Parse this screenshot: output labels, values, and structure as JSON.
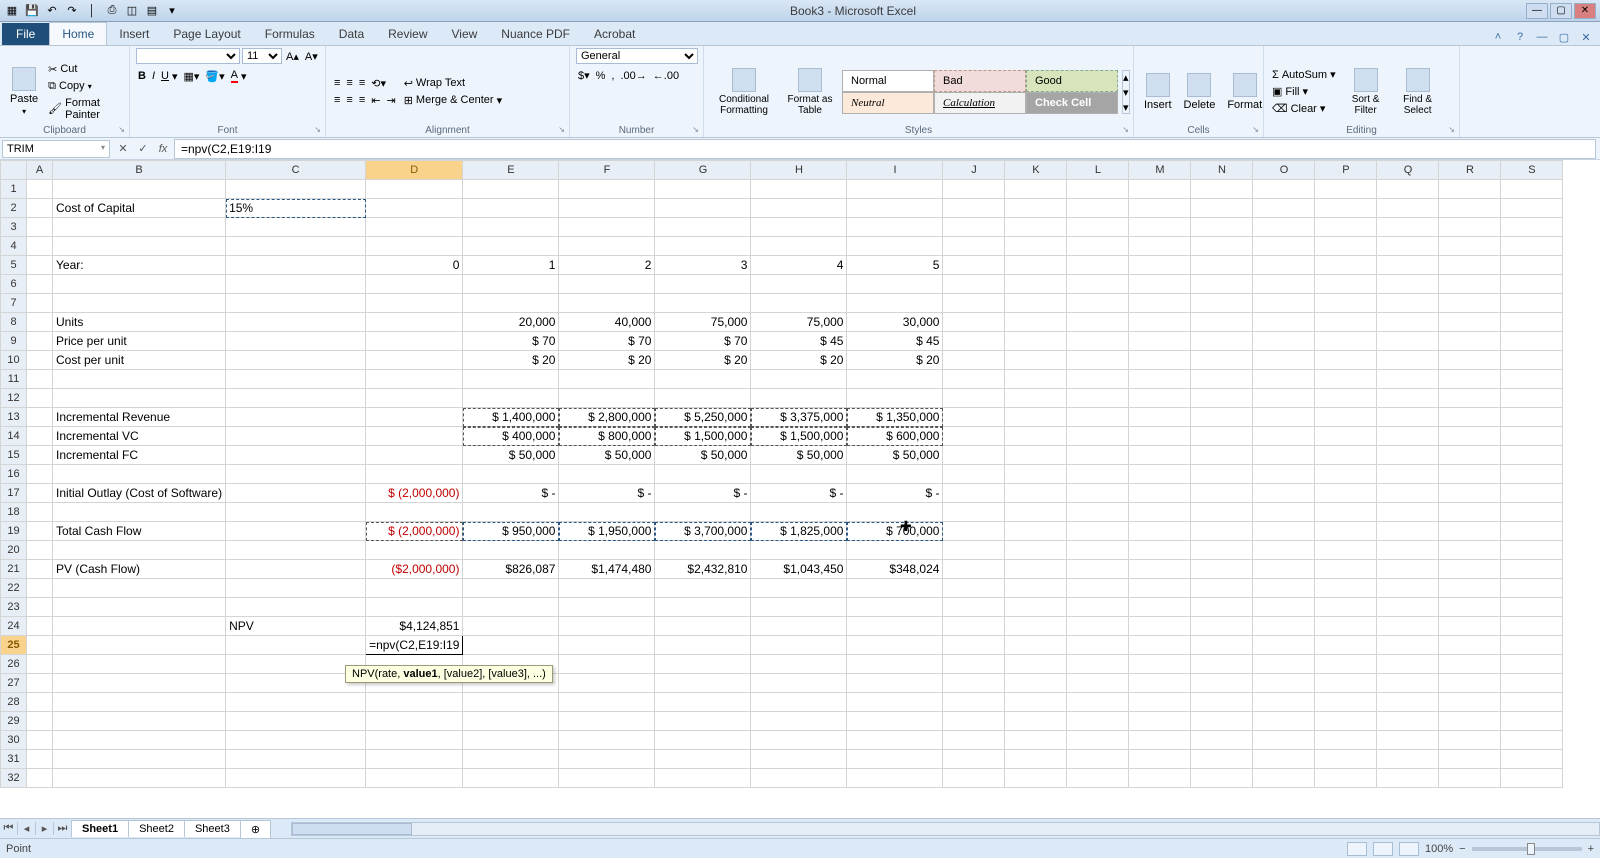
{
  "app": {
    "title": "Book3 - Microsoft Excel"
  },
  "qat_icons": [
    "excel",
    "save",
    "undo",
    "redo",
    "sep",
    "print",
    "preview",
    "sep",
    "1",
    "2",
    "3"
  ],
  "tabs": {
    "file": "File",
    "items": [
      "Home",
      "Insert",
      "Page Layout",
      "Formulas",
      "Data",
      "Review",
      "View",
      "Nuance PDF",
      "Acrobat"
    ],
    "active": "Home"
  },
  "ribbon": {
    "clipboard": {
      "label": "Clipboard",
      "paste": "Paste",
      "cut": "Cut",
      "copy": "Copy",
      "fmtpainter": "Format Painter"
    },
    "font": {
      "label": "Font",
      "size": "11"
    },
    "alignment": {
      "label": "Alignment",
      "wrap": "Wrap Text",
      "merge": "Merge & Center"
    },
    "number": {
      "label": "Number",
      "format": "General"
    },
    "styles": {
      "label": "Styles",
      "cond": "Conditional Formatting",
      "table": "Format as Table",
      "cells": [
        "Normal",
        "Bad",
        "Good",
        "Neutral",
        "Calculation",
        "Check Cell"
      ]
    },
    "cells": {
      "label": "Cells",
      "insert": "Insert",
      "delete": "Delete",
      "format": "Format"
    },
    "editing": {
      "label": "Editing",
      "autosum": "AutoSum",
      "fill": "Fill",
      "clear": "Clear",
      "sort": "Sort & Filter",
      "find": "Find & Select"
    }
  },
  "formula_bar": {
    "name": "TRIM",
    "formula": "=npv(C2,E19:I19"
  },
  "columns": [
    "A",
    "B",
    "C",
    "D",
    "E",
    "F",
    "G",
    "H",
    "I",
    "J",
    "K",
    "L",
    "M",
    "N",
    "O",
    "P",
    "Q",
    "R",
    "S"
  ],
  "active_col": "D",
  "active_row": 25,
  "sheet": {
    "B2": "Cost of Capital",
    "C2": "15%",
    "B5": "Year:",
    "D5": "0",
    "E5": "1",
    "F5": "2",
    "G5": "3",
    "H5": "4",
    "I5": "5",
    "B8": "Units",
    "E8": "20,000",
    "F8": "40,000",
    "G8": "75,000",
    "H8": "75,000",
    "I8": "30,000",
    "B9": "Price per unit",
    "E9": "$        70",
    "F9": "$        70",
    "G9": "$        70",
    "H9": "$        45",
    "I9": "$        45",
    "B10": "Cost per unit",
    "E10": "$        20",
    "F10": "$        20",
    "G10": "$        20",
    "H10": "$        20",
    "I10": "$        20",
    "B13": "Incremental Revenue",
    "E13": "$   1,400,000",
    "F13": "$   2,800,000",
    "G13": "$   5,250,000",
    "H13": "$   3,375,000",
    "I13": "$   1,350,000",
    "B14": "Incremental VC",
    "E14": "$      400,000",
    "F14": "$      800,000",
    "G14": "$   1,500,000",
    "H14": "$   1,500,000",
    "I14": "$      600,000",
    "B15": "Incremental FC",
    "E15": "$        50,000",
    "F15": "$        50,000",
    "G15": "$        50,000",
    "H15": "$        50,000",
    "I15": "$        50,000",
    "B17": "Initial Outlay (Cost of Software)",
    "D17": "$   (2,000,000)",
    "E17": "$             -",
    "F17": "$             -",
    "G17": "$             -",
    "H17": "$             -",
    "I17": "$             -",
    "B19": "Total Cash Flow",
    "D19": "$   (2,000,000)",
    "E19": "$      950,000",
    "F19": "$   1,950,000",
    "G19": "$   3,700,000",
    "H19": "$   1,825,000",
    "I19": "$      700,000",
    "B21": "PV (Cash Flow)",
    "D21": "($2,000,000)",
    "E21": "$826,087",
    "F21": "$1,474,480",
    "G21": "$2,432,810",
    "H21": "$1,043,450",
    "I21": "$348,024",
    "C24": "NPV",
    "D24": "$4,124,851",
    "D25": "=npv(C2,E19:I19"
  },
  "tooltip": {
    "pre": "NPV(rate, ",
    "bold": "value1",
    "post": ", [value2], [value3], ...)"
  },
  "sheets": {
    "items": [
      "Sheet1",
      "Sheet2",
      "Sheet3"
    ],
    "active": "Sheet1"
  },
  "status": {
    "mode": "Point",
    "zoom": "100%"
  }
}
